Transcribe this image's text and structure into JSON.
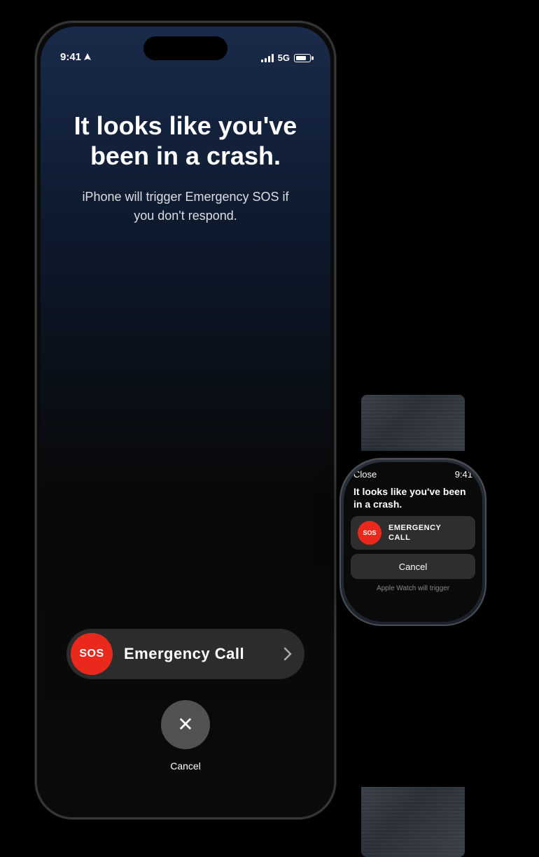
{
  "iphone": {
    "status_time": "9:41",
    "signal_label": "5G",
    "main_title": "It looks like you've been in a crash.",
    "subtitle": "iPhone will trigger Emergency SOS if you don't respond.",
    "sos_label": "SOS",
    "emergency_call_label": "Emergency Call",
    "cancel_label": "Cancel"
  },
  "watch": {
    "close_label": "Close",
    "time_label": "9:41",
    "title": "It looks like you've been in a crash.",
    "sos_label": "SOS",
    "emergency_call_label": "EMERGENCY\nCALL",
    "cancel_label": "Cancel",
    "trigger_label": "Apple Watch will trigger"
  },
  "colors": {
    "sos_red": "#e8291c",
    "background_dark": "#000000",
    "iphone_gradient_top": "#1a2a4a",
    "iphone_gradient_mid": "#0d1a2e"
  }
}
